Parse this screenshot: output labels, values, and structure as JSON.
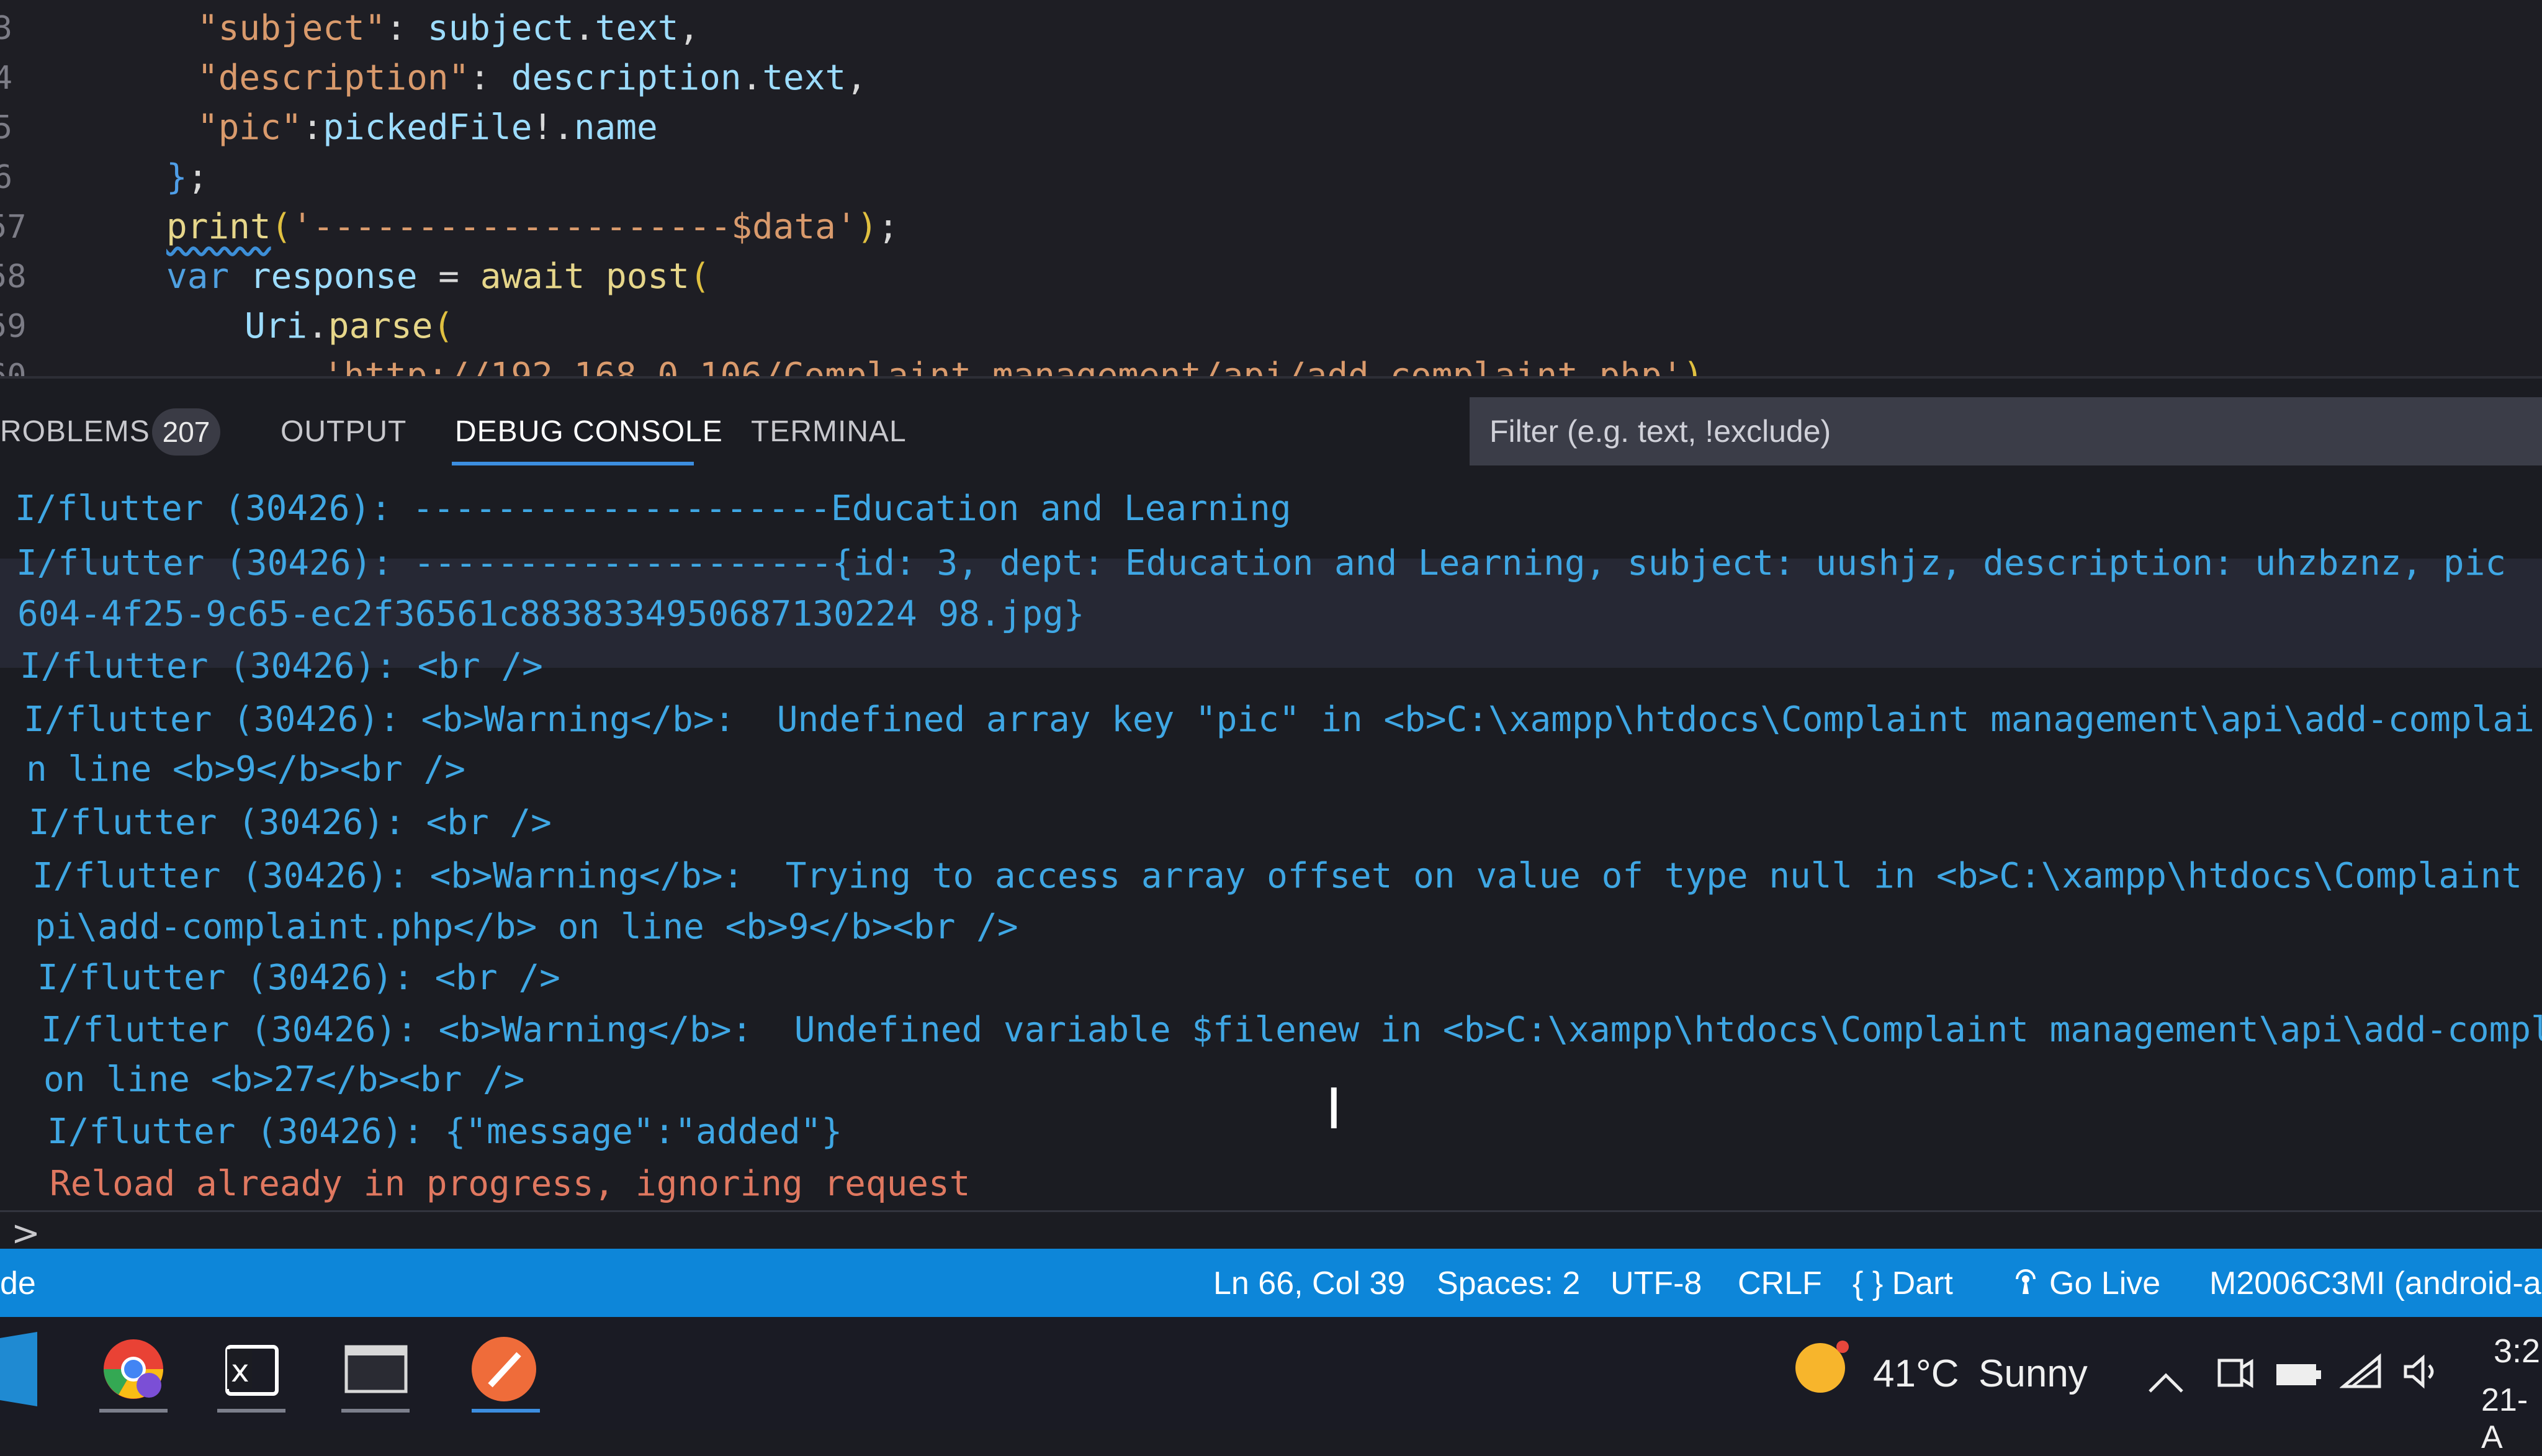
{
  "editor": {
    "lines": [
      {
        "num": "3",
        "parts": [
          [
            "str",
            "\"subject\""
          ],
          [
            "punc",
            ": "
          ],
          [
            "var",
            "subject"
          ],
          [
            "punc",
            "."
          ],
          [
            "var",
            "text"
          ],
          [
            "punc",
            ","
          ]
        ]
      },
      {
        "num": "4",
        "parts": [
          [
            "str",
            "\"description\""
          ],
          [
            "punc",
            ": "
          ],
          [
            "var",
            "description"
          ],
          [
            "punc",
            "."
          ],
          [
            "var",
            "text"
          ],
          [
            "punc",
            ","
          ]
        ]
      },
      {
        "num": "5",
        "parts": [
          [
            "str",
            "\"pic\""
          ],
          [
            "punc",
            ":"
          ],
          [
            "var",
            "pickedFile"
          ],
          [
            "punc",
            "!."
          ],
          [
            "var",
            "name"
          ]
        ]
      },
      {
        "num": "6",
        "parts": [
          [
            "brace",
            "}"
          ],
          [
            "punc",
            ";"
          ]
        ]
      },
      {
        "num": "57",
        "parts": [
          [
            "fn-squiggle",
            "print"
          ],
          [
            "bracket",
            "("
          ],
          [
            "str",
            "'--------------------$data'"
          ],
          [
            "bracket",
            ")"
          ],
          [
            "punc",
            ";"
          ]
        ]
      },
      {
        "num": "58",
        "parts": [
          [
            "kw",
            "var"
          ],
          [
            "punc",
            " "
          ],
          [
            "var",
            "response"
          ],
          [
            "punc",
            " = "
          ],
          [
            "fn",
            "await"
          ],
          [
            "punc",
            " "
          ],
          [
            "fn",
            "post"
          ],
          [
            "bracket",
            "("
          ]
        ]
      },
      {
        "num": "59",
        "parts": [
          [
            "var",
            "Uri"
          ],
          [
            "punc",
            "."
          ],
          [
            "fn",
            "parse"
          ],
          [
            "bracket",
            "("
          ]
        ]
      },
      {
        "num": "60",
        "parts": [
          [
            "str",
            "'http://192.168.0.106/Complaint_management/api/add-complaint.php'"
          ],
          [
            "bracket",
            ")"
          ]
        ]
      }
    ]
  },
  "panel": {
    "tabs": {
      "problems": "ROBLEMS",
      "problems_count": "207",
      "output": "OUTPUT",
      "debug_console": "DEBUG CONSOLE",
      "terminal": "TERMINAL"
    },
    "filter_placeholder": "Filter (e.g. text, !exclude)",
    "console_lines": [
      "I/flutter (30426): --------------------Education and Learning",
      "I/flutter (30426): --------------------{id: 3, dept: Education and Learning, subject: uushjz, description: uhzbznz, pic",
      "604-4f25-9c65-ec2f36561c8838334950687130224 98.jpg}",
      "I/flutter (30426): <br />",
      "I/flutter (30426): <b>Warning</b>:  Undefined array key \"pic\" in <b>C:\\xampp\\htdocs\\Complaint management\\api\\add-complai",
      "n line <b>9</b><br />",
      "I/flutter (30426): <br />",
      "I/flutter (30426): <b>Warning</b>:  Trying to access array offset on value of type null in <b>C:\\xampp\\htdocs\\Complaint m",
      "pi\\add-complaint.php</b> on line <b>9</b><br />",
      "I/flutter (30426): <br />",
      "I/flutter (30426): <b>Warning</b>:  Undefined variable $filenew in <b>C:\\xampp\\htdocs\\Complaint management\\api\\add-compla",
      "on line <b>27</b><br />",
      "I/flutter (30426): {\"message\":\"added\"}",
      "Reload already in progress, ignoring request"
    ]
  },
  "statusbar": {
    "left": "de",
    "position": "Ln 66, Col 39",
    "spaces": "Spaces: 2",
    "encoding": "UTF-8",
    "eol": "CRLF",
    "language": "{ } Dart",
    "golive": "Go Live",
    "device": "M2006C3MI (android-a"
  },
  "taskbar": {
    "weather_temp": "41°C",
    "weather_desc": "Sunny",
    "time": "3:2",
    "date": "21-A",
    "colors": {
      "status": "#0d86d9",
      "chrome": "#e94235",
      "excel": "#1d6f42"
    },
    "apps": [
      "vscode-icon",
      "chrome-icon",
      "excel-icon",
      "terminal-icon",
      "postman-icon"
    ]
  }
}
